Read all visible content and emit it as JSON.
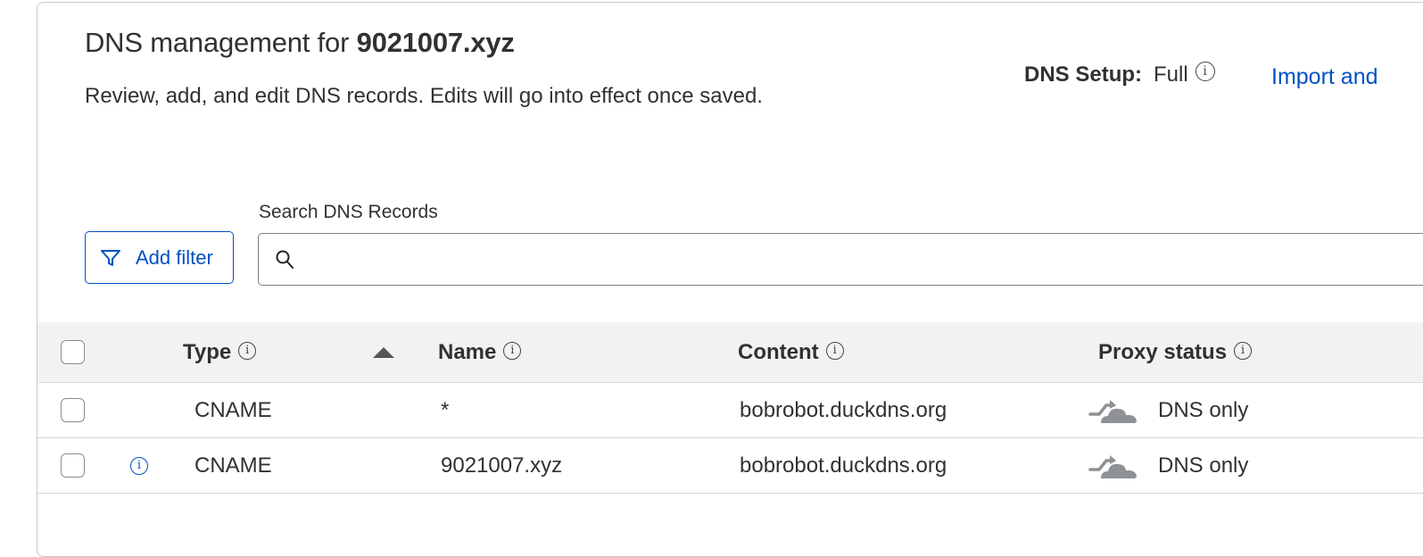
{
  "header": {
    "title_prefix": "DNS management for ",
    "domain": "9021007.xyz",
    "description": "Review, add, and edit DNS records. Edits will go into effect once saved.",
    "dns_setup_label": "DNS Setup:",
    "dns_setup_value": "Full",
    "import_link": "Import and"
  },
  "toolbar": {
    "filter_button": "Add filter",
    "search_label": "Search DNS Records",
    "search_value": "",
    "search_placeholder": ""
  },
  "table": {
    "columns": [
      {
        "label": "Type",
        "info": true,
        "sort": "ascending"
      },
      {
        "label": "Name",
        "info": true
      },
      {
        "label": "Content",
        "info": true
      },
      {
        "label": "Proxy status",
        "info": true
      }
    ],
    "rows": [
      {
        "type": "CNAME",
        "name": "*",
        "content": "bobrobot.duckdns.org",
        "proxy_status": "DNS only",
        "proxy_icon": "dns-only-cloud-icon",
        "has_info": false
      },
      {
        "type": "CNAME",
        "name": "9021007.xyz",
        "content": "bobrobot.duckdns.org",
        "proxy_status": "DNS only",
        "proxy_icon": "dns-only-cloud-icon",
        "has_info": true
      }
    ]
  },
  "icons": {
    "info": "ⓘ",
    "filter": "filter-icon",
    "search": "search-icon",
    "sort": "sort-ascending-icon"
  },
  "colors": {
    "link": "#0051c3",
    "text": "#313131",
    "header_bg": "#f2f2f2",
    "cloud_gray": "#8e9296"
  }
}
